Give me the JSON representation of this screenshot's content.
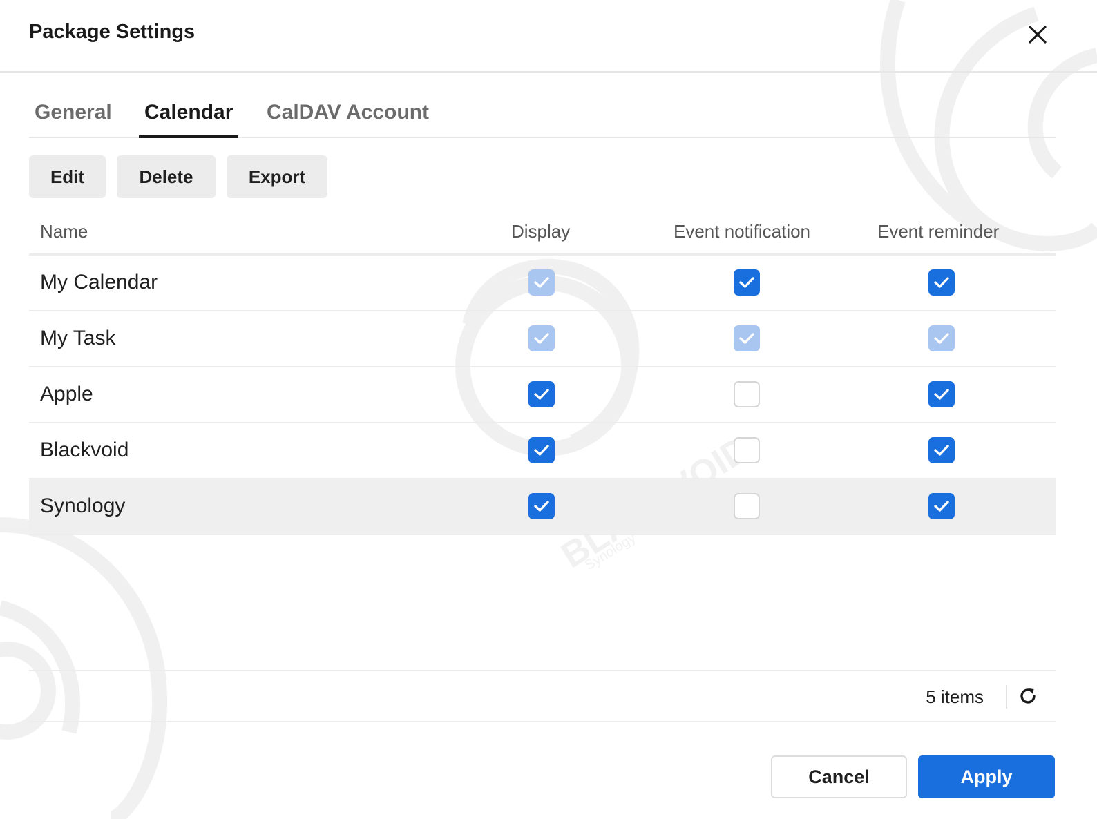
{
  "dialog": {
    "title": "Package Settings"
  },
  "tabs": [
    {
      "label": "General",
      "active": false
    },
    {
      "label": "Calendar",
      "active": true
    },
    {
      "label": "CalDAV Account",
      "active": false
    }
  ],
  "toolbar": {
    "edit_label": "Edit",
    "delete_label": "Delete",
    "export_label": "Export"
  },
  "table": {
    "columns": [
      "Name",
      "Display",
      "Event notification",
      "Event reminder"
    ],
    "rows": [
      {
        "name": "My Calendar",
        "display": "checked-disabled",
        "notification": "checked",
        "reminder": "checked",
        "selected": false
      },
      {
        "name": "My Task",
        "display": "checked-disabled",
        "notification": "checked-disabled",
        "reminder": "checked-disabled",
        "selected": false
      },
      {
        "name": "Apple",
        "display": "checked",
        "notification": "unchecked",
        "reminder": "checked",
        "selected": false
      },
      {
        "name": "Blackvoid",
        "display": "checked",
        "notification": "unchecked",
        "reminder": "checked",
        "selected": false
      },
      {
        "name": "Synology",
        "display": "checked",
        "notification": "unchecked",
        "reminder": "checked",
        "selected": true
      }
    ]
  },
  "footer": {
    "item_count": "5 items"
  },
  "actions": {
    "cancel_label": "Cancel",
    "apply_label": "Apply"
  },
  "colors": {
    "accent": "#1a6fdf",
    "accent_disabled": "#a9c6f1",
    "selected_row": "#efefef"
  },
  "icons": {
    "close": "close-icon",
    "refresh": "refresh-icon",
    "check": "check-icon"
  },
  "watermark": {
    "text": "BLACKVOID",
    "subtext": "Synology"
  }
}
